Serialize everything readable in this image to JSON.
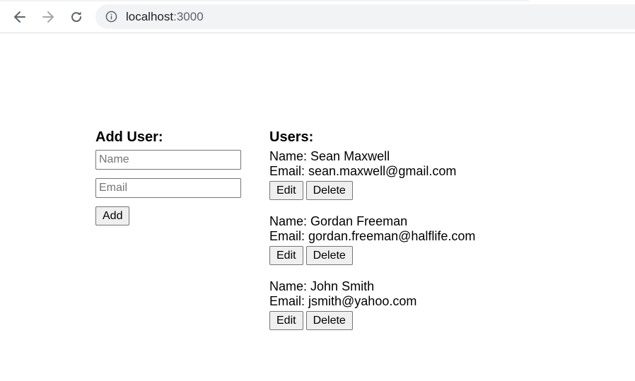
{
  "browser": {
    "url_host": "localhost",
    "url_port": ":3000",
    "icons": {
      "back": "back-arrow-icon",
      "forward": "forward-arrow-icon",
      "reload": "reload-icon",
      "site_info": "info-icon"
    }
  },
  "add_user": {
    "title": "Add User:",
    "name_placeholder": "Name",
    "name_value": "",
    "email_placeholder": "Email",
    "email_value": "",
    "add_label": "Add"
  },
  "users": {
    "title": "Users:",
    "name_prefix": "Name: ",
    "email_prefix": "Email: ",
    "edit_label": "Edit",
    "delete_label": "Delete",
    "items": [
      {
        "name": "Sean Maxwell",
        "email": "sean.maxwell@gmail.com"
      },
      {
        "name": "Gordan Freeman",
        "email": "gordan.freeman@halflife.com"
      },
      {
        "name": "John Smith",
        "email": "jsmith@yahoo.com"
      }
    ]
  }
}
